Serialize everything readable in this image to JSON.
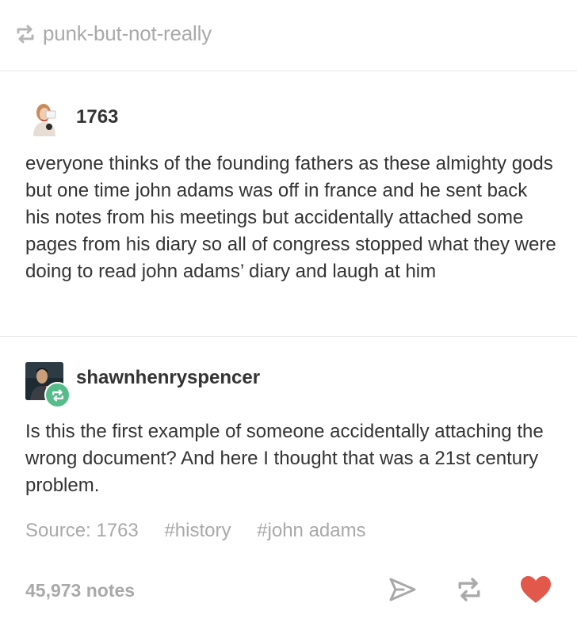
{
  "reblog_header": {
    "blog_name": "punk-but-not-really",
    "icon": "reblog-icon"
  },
  "posts": [
    {
      "username": "1763",
      "avatar": "woman-avatar",
      "body": "everyone thinks of the founding fathers as these almighty gods but one time john adams was off in france and he sent back his notes from his meetings but accidentally attached some pages from his diary so all of congress stopped what they were doing to read john adams’ diary and laugh at him"
    },
    {
      "username": "shawnhenryspencer",
      "avatar": "spock-avatar",
      "badge": "reblog-badge-icon",
      "body": "Is this the first example of someone accidentally attaching the wrong document? And here I thought that was a 21st century problem."
    }
  ],
  "source_tags": {
    "source": "Source: 1763",
    "tags": [
      "#history",
      "#john adams"
    ]
  },
  "footer": {
    "notes": "45,973 notes",
    "icons": [
      "share-icon",
      "reblog-icon",
      "like-heart-icon"
    ]
  },
  "colors": {
    "reblog_green": "#56bc8a",
    "heart": "#e2594b",
    "muted": "#a9a9a9",
    "text": "#333333"
  }
}
